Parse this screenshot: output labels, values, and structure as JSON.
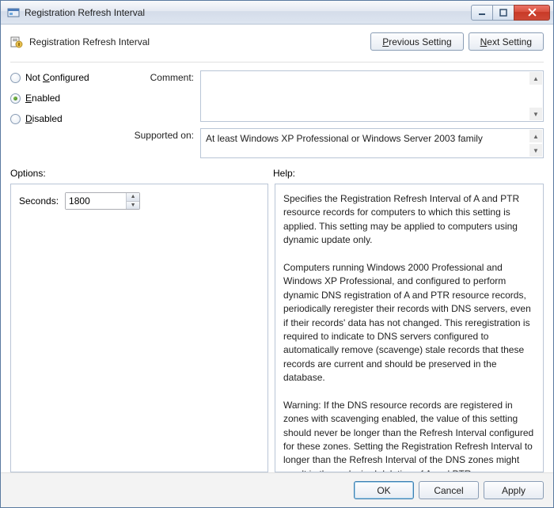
{
  "window": {
    "title": "Registration Refresh Interval"
  },
  "header": {
    "title": "Registration Refresh Interval",
    "prev": "Previous Setting",
    "next_prefix": "N",
    "next_rest": "ext Setting"
  },
  "radios": {
    "not_configured_prefix": "Not ",
    "not_configured_ul": "C",
    "not_configured_rest": "onfigured",
    "enabled_ul": "E",
    "enabled_rest": "nabled",
    "disabled_ul": "D",
    "disabled_rest": "isabled",
    "selected": "enabled"
  },
  "comment": {
    "label": "Comment:",
    "value": ""
  },
  "supported": {
    "label": "Supported on:",
    "value": "At least Windows XP Professional or Windows Server 2003 family"
  },
  "labels": {
    "options": "Options:",
    "help": "Help:"
  },
  "options": {
    "seconds_label": "Seconds:",
    "seconds_value": "1800"
  },
  "help_text": "Specifies the Registration Refresh Interval of A and PTR resource records for computers to which this setting is applied. This setting may be applied to computers using dynamic update only.\n\nComputers running Windows 2000 Professional and Windows XP Professional, and configured to perform dynamic DNS registration of A and PTR resource records, periodically reregister their records with DNS servers, even if their records' data has not changed. This reregistration is required to indicate to DNS servers configured to automatically remove (scavenge) stale records that these records are current and should be preserved in the database.\n\nWarning: If the DNS resource records are registered in zones with scavenging enabled, the value of this setting should never be longer than the Refresh Interval configured for these zones. Setting the Registration Refresh Interval to longer than the Refresh Interval of the DNS zones might result in the undesired deletion of A and PTR resource records.",
  "footer": {
    "ok": "OK",
    "cancel": "Cancel",
    "apply": "Apply"
  }
}
